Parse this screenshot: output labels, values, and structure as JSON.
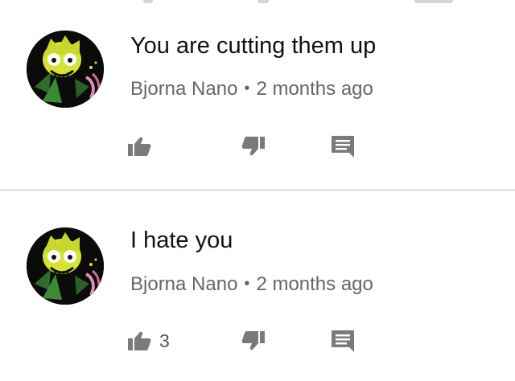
{
  "colors": {
    "text_primary": "#111111",
    "text_secondary": "#666666",
    "icon": "#7a7a7a",
    "divider": "#e6e6e6",
    "background": "#ffffff"
  },
  "comments": [
    {
      "avatar_icon": "yellow-creature-avatar-icon",
      "text": "You are cutting them up",
      "author": "Bjorna Nano",
      "separator": "•",
      "time": "2 months ago",
      "like_count": "",
      "like_icon": "thumbs-up-icon",
      "dislike_icon": "thumbs-down-icon",
      "reply_icon": "reply-comment-icon"
    },
    {
      "avatar_icon": "yellow-creature-avatar-icon",
      "text": "I hate you",
      "author": "Bjorna Nano",
      "separator": "•",
      "time": "2 months ago",
      "like_count": "3",
      "like_icon": "thumbs-up-icon",
      "dislike_icon": "thumbs-down-icon",
      "reply_icon": "reply-comment-icon"
    }
  ]
}
